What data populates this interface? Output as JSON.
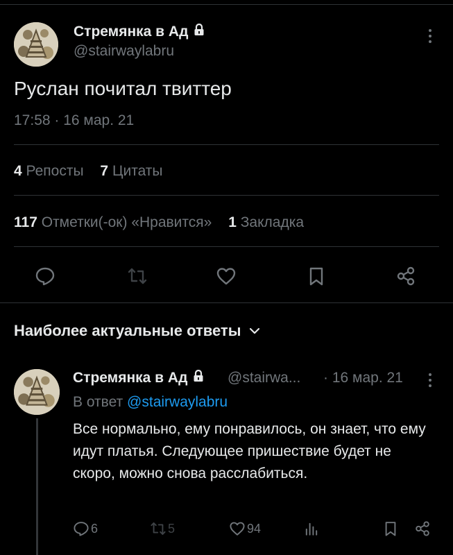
{
  "tweet": {
    "author_name": "Стремянка в Ад",
    "author_handle": "@stairwaylabru",
    "text": "Руслан почитал твиттер",
    "time": "17:58 · 16 мар. 21",
    "reposts_count": "4",
    "reposts_label": "Репосты",
    "quotes_count": "7",
    "quotes_label": "Цитаты",
    "likes_count": "117",
    "likes_label": "Отметки(-ок) «Нравится»",
    "bookmarks_count": "1",
    "bookmarks_label": "Закладка"
  },
  "replies_section": {
    "title": "Наиболее актуальные ответы"
  },
  "reply": {
    "author_name": "Стремянка в Ад",
    "author_handle": "@stairwa...",
    "date": "· 16 мар. 21",
    "reply_to_prefix": "В ответ",
    "reply_to_handle": "@stairwaylabru",
    "text": "Все нормально, ему понравилось, он знает, что ему идут платья. Следующее пришествие будет не скоро, можно снова расслабиться.",
    "replies": "6",
    "reposts": "5",
    "likes": "94"
  },
  "colors": {
    "background": "#000000",
    "text": "#e7e9ea",
    "muted": "#71767b",
    "accent": "#1d9bf0",
    "divider": "#2f3336"
  },
  "icons": [
    "lock-icon",
    "more-icon",
    "reply-icon",
    "repost-icon",
    "like-icon",
    "bookmark-icon",
    "share-icon",
    "chevron-down-icon",
    "views-icon"
  ]
}
